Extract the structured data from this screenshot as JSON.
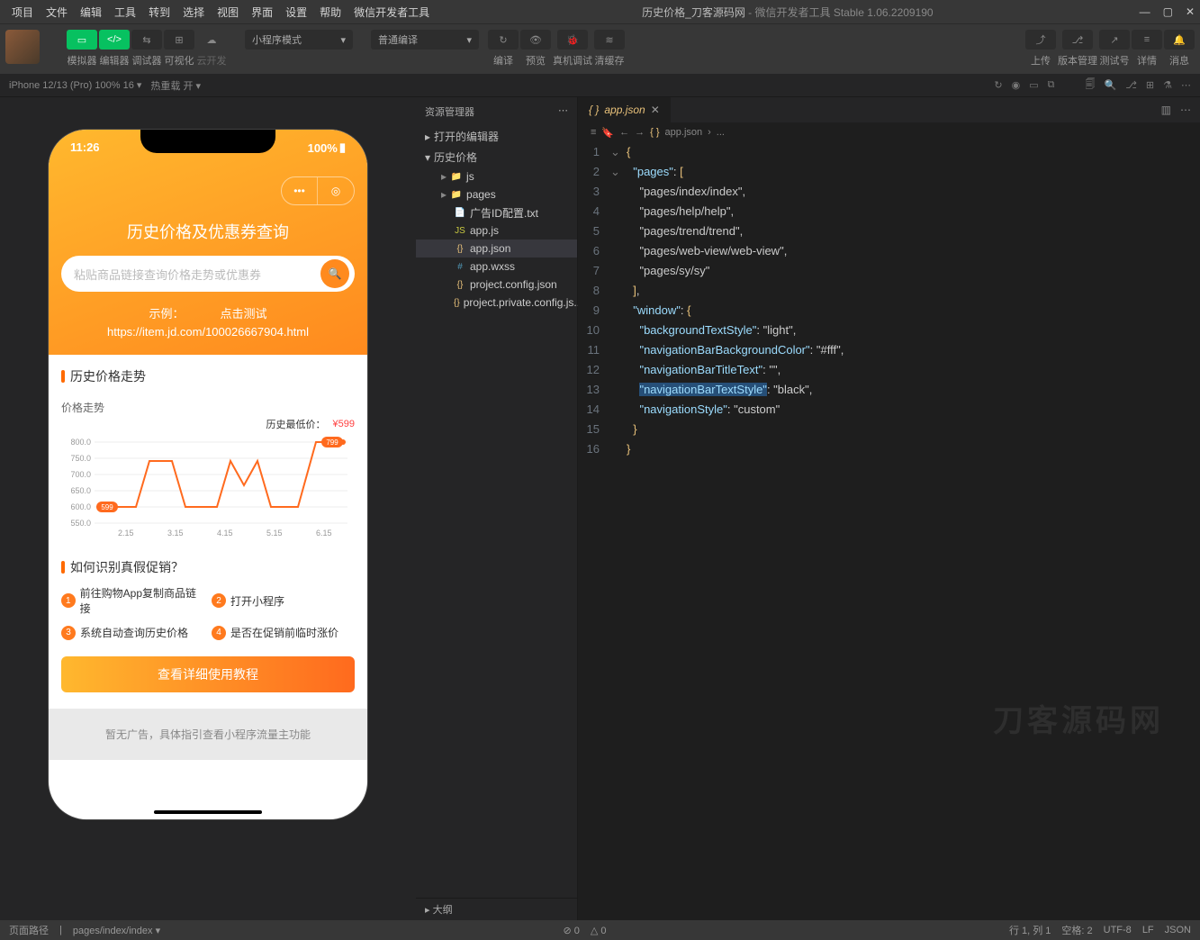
{
  "menubar": {
    "items": [
      "项目",
      "文件",
      "编辑",
      "工具",
      "转到",
      "选择",
      "视图",
      "界面",
      "设置",
      "帮助",
      "微信开发者工具"
    ],
    "title_main": "历史价格_刀客源码网",
    "title_sub": " - 微信开发者工具 Stable 1.06.2209190"
  },
  "toolbar": {
    "left": [
      {
        "label": "模拟器"
      },
      {
        "label": "编辑器"
      },
      {
        "label": "调试器"
      },
      {
        "label": "可视化"
      },
      {
        "label": "云开发"
      }
    ],
    "mode": "小程序模式",
    "compile": "普通编译",
    "mid": [
      "编译",
      "预览",
      "真机调试",
      "清缓存"
    ],
    "right": [
      "上传",
      "版本管理",
      "测试号",
      "详情",
      "消息"
    ]
  },
  "devicebar": {
    "device": "iPhone 12/13 (Pro) 100% 16",
    "reload": "热重载 开"
  },
  "phone": {
    "time": "11:26",
    "battery": "100%",
    "title": "历史价格及优惠券查询",
    "placeholder": "粘贴商品链接查询价格走势或优惠券",
    "example_label": "示例：",
    "example_btn": "点击测试",
    "example_url": "https://item.jd.com/100026667904.html",
    "section1": "历史价格走势",
    "chart_title": "价格走势",
    "chart_low_label": "历史最低价：",
    "chart_low_value": "¥599",
    "section2": "如何识别真假促销？",
    "steps": [
      "前往购物App复制商品链接",
      "打开小程序",
      "系统自动查询历史价格",
      "是否在促销前临时涨价"
    ],
    "bigbtn": "查看详细使用教程",
    "ad": "暂无广告，具体指引查看小程序流量主功能"
  },
  "chart_data": {
    "type": "line",
    "title": "价格走势",
    "ylabel": "",
    "ylim": [
      550,
      800
    ],
    "y_ticks": [
      550,
      600,
      650,
      700,
      750,
      800
    ],
    "categories": [
      "2.15",
      "3.15",
      "4.15",
      "5.15",
      "6.15"
    ],
    "values": [
      599,
      599,
      740,
      740,
      600,
      600,
      740,
      660,
      740,
      600,
      600,
      799,
      799
    ],
    "annotations": [
      {
        "label": "599",
        "x_index": 0
      },
      {
        "label": "799",
        "x_index": 12
      }
    ],
    "history_low": 599
  },
  "explorer": {
    "title": "资源管理器",
    "cat1": "打开的编辑器",
    "cat2": "历史价格",
    "items": [
      {
        "icon": "📁",
        "name": "js",
        "color": "#c09553"
      },
      {
        "icon": "📁",
        "name": "pages",
        "color": "#c09553"
      },
      {
        "icon": "📄",
        "name": "广告ID配置.txt",
        "color": "#519aba",
        "depth": 2
      },
      {
        "icon": "JS",
        "name": "app.js",
        "color": "#cbcb41",
        "depth": 2
      },
      {
        "icon": "{}",
        "name": "app.json",
        "color": "#e8c17a",
        "depth": 2,
        "sel": true
      },
      {
        "icon": "#",
        "name": "app.wxss",
        "color": "#519aba",
        "depth": 2
      },
      {
        "icon": "{}",
        "name": "project.config.json",
        "color": "#e8c17a",
        "depth": 2
      },
      {
        "icon": "{}",
        "name": "project.private.config.js...",
        "color": "#e8c17a",
        "depth": 2
      }
    ],
    "outline": "大纲"
  },
  "editor": {
    "tab": "app.json",
    "crumb": "app.json",
    "crumb_extra": "...",
    "lines": [
      {
        "n": 1,
        "t": "{"
      },
      {
        "n": 2,
        "t": "  \"pages\": ["
      },
      {
        "n": 3,
        "t": "    \"pages/index/index\","
      },
      {
        "n": 4,
        "t": "    \"pages/help/help\","
      },
      {
        "n": 5,
        "t": "    \"pages/trend/trend\","
      },
      {
        "n": 6,
        "t": "    \"pages/web-view/web-view\","
      },
      {
        "n": 7,
        "t": "    \"pages/sy/sy\""
      },
      {
        "n": 8,
        "t": "  ],"
      },
      {
        "n": 9,
        "t": "  \"window\": {"
      },
      {
        "n": 10,
        "t": "    \"backgroundTextStyle\": \"light\","
      },
      {
        "n": 11,
        "t": "    \"navigationBarBackgroundColor\": \"#fff\","
      },
      {
        "n": 12,
        "t": "    \"navigationBarTitleText\": \"\","
      },
      {
        "n": 13,
        "t": "    \"navigationBarTextStyle\": \"black\","
      },
      {
        "n": 14,
        "t": "    \"navigationStyle\": \"custom\""
      },
      {
        "n": 15,
        "t": "  }"
      },
      {
        "n": 16,
        "t": "}"
      }
    ]
  },
  "statusbar": {
    "path_label": "页面路径",
    "path": "pages/index/index",
    "err": "⊘ 0",
    "warn": "△ 0",
    "pos": "行 1, 列 1",
    "spaces": "空格: 2",
    "enc": "UTF-8",
    "eol": "LF",
    "lang": "JSON"
  },
  "watermark": "刀客源码网"
}
